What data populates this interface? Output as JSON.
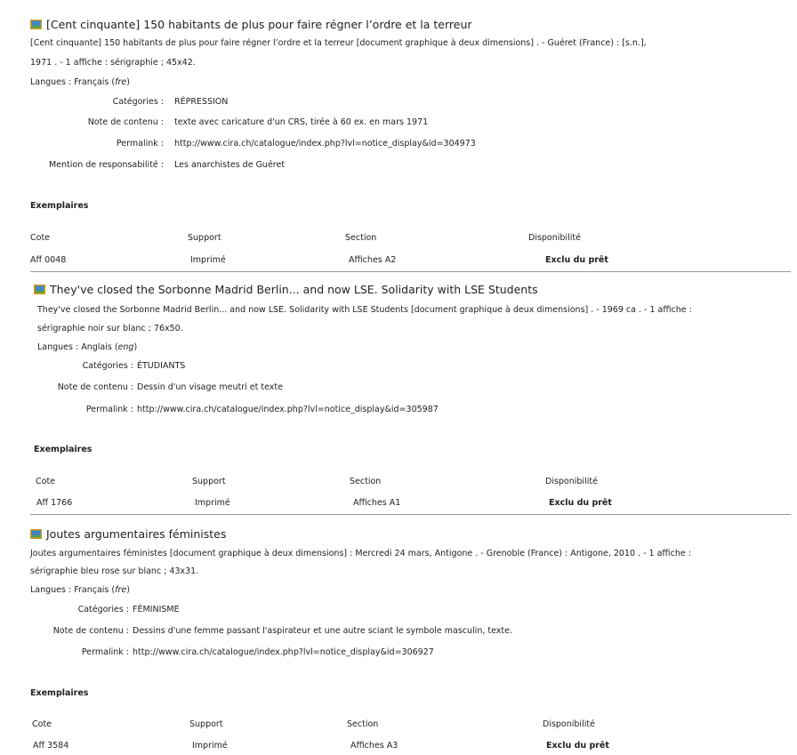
{
  "notices": [
    {
      "title": "[Cent cinquante] 150 habitants de plus pour faire régner l’ordre et la terreur",
      "desc_line1": "[Cent cinquante] 150 habitants de plus pour faire régner l’ordre et la terreur [document graphique à deux dimensions] . - Guéret (France) : [s.n.],",
      "desc_line2": "1971 . - 1 affiche : sérigraphie ; 45x42.",
      "langues_prefix": "Langues : Français (",
      "langues_code": "fre",
      "langues_suffix": ")",
      "fields": [
        {
          "label": "Catégories :",
          "value": "RÉPRESSION"
        },
        {
          "label": "Note de contenu :",
          "value": "texte avec caricature d'un CRS, tirée à 60 ex. en mars 1971"
        },
        {
          "label": "Permalink :",
          "value": "http://www.cira.ch/catalogue/index.php?lvl=notice_display&id=304973"
        },
        {
          "label": "Mention de responsabilité :",
          "value": "Les anarchistes de Guéret"
        }
      ],
      "exemplaires_title": "Exemplaires",
      "columns": [
        "Cote",
        "Support",
        "Section",
        "Disponibilité"
      ],
      "row": [
        "Aff 0048",
        "Imprimé",
        "Affiches A2",
        "Exclu du prêt"
      ]
    },
    {
      "title": "They've closed the Sorbonne Madrid Berlin... and now LSE. Solidarity with LSE Students",
      "desc_line1": "They've closed the Sorbonne Madrid Berlin... and now LSE. Solidarity with LSE Students [document graphique à deux dimensions] . - 1969 ca . - 1 affiche :",
      "desc_line2": "sérigraphie noir sur blanc ; 76x50.",
      "langues_prefix": "Langues : Anglais (",
      "langues_code": "eng",
      "langues_suffix": ")",
      "fields": [
        {
          "label": "Catégories :",
          "value": "ÉTUDIANTS"
        },
        {
          "label": "Note de contenu :",
          "value": "Dessin d'un visage meutri et texte"
        },
        {
          "label": "Permalink :",
          "value": "http://www.cira.ch/catalogue/index.php?lvl=notice_display&id=305987"
        }
      ],
      "exemplaires_title": "Exemplaires",
      "columns": [
        "Cote",
        "Support",
        "Section",
        "Disponibilité"
      ],
      "row": [
        "Aff 1766",
        "Imprimé",
        "Affiches A1",
        "Exclu du prêt"
      ]
    },
    {
      "title": "Joutes argumentaires féministes",
      "desc_line1": "Joutes argumentaires féministes [document graphique à deux dimensions] : Mercredi 24 mars, Antigone . - Grenoble (France) : Antigone, 2010 . - 1 affiche :",
      "desc_line2": "sérigraphie bleu rose sur blanc ; 43x31.",
      "langues_prefix": "Langues : Français (",
      "langues_code": "fre",
      "langues_suffix": ")",
      "fields": [
        {
          "label": "Catégories :",
          "value": "FÉMINISME"
        },
        {
          "label": "Note de contenu :",
          "value": "Dessins d'une femme passant l'aspirateur et une autre sciant le symbole masculin, texte."
        },
        {
          "label": "Permalink :",
          "value": "http://www.cira.ch/catalogue/index.php?lvl=notice_display&id=306927"
        }
      ],
      "exemplaires_title": "Exemplaires",
      "columns": [
        "Cote",
        "Support",
        "Section",
        "Disponibilité"
      ],
      "row": [
        "Aff 3584",
        "Imprimé",
        "Affiches A3",
        "Exclu du prêt"
      ]
    }
  ]
}
